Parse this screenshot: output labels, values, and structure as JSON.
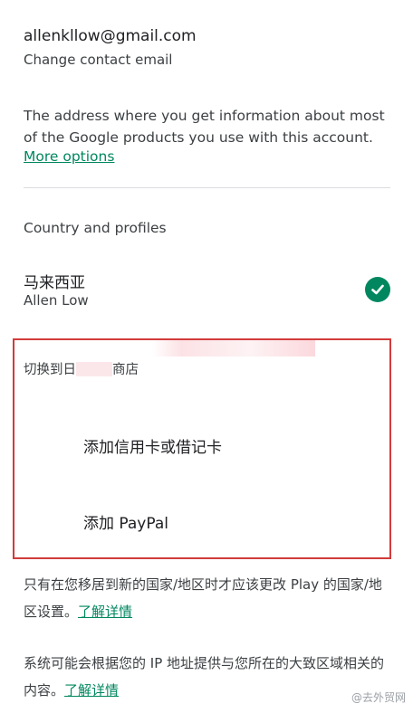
{
  "account": {
    "email": "allenkllow@gmail.com",
    "change_email_label": "Change contact email",
    "description": "The address where you get information about most of the Google products you use with this account.",
    "more_options_label": "More options"
  },
  "country_section": {
    "title": "Country and profiles",
    "current_country": "马来西亚",
    "profile_name": "Allen Low"
  },
  "highlight": {
    "switch_store_prefix": "切换到日",
    "switch_store_suffix": "商店",
    "add_card_label": "添加信用卡或借记卡",
    "add_paypal_label": "添加 PayPal"
  },
  "notes": [
    {
      "text": "只有在您移居到新的国家/地区时才应该更改 Play 的国家/地区设置。",
      "link": "了解详情"
    },
    {
      "text": "系统可能会根据您的 IP 地址提供与您所在的大致区域相关的内容。",
      "link": "了解详情"
    }
  ],
  "watermark": "@去外贸网",
  "colors": {
    "accent_green": "#01875f",
    "highlight_border": "#d23b3b"
  }
}
